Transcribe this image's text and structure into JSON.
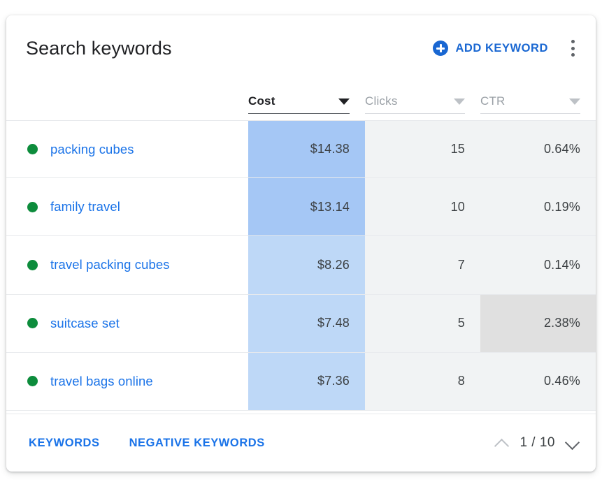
{
  "card": {
    "title": "Search keywords",
    "add_keyword_label": "ADD KEYWORD",
    "add_icon": "plus-circle-icon",
    "overflow_icon": "more-vert-icon",
    "accent_color": "#1a73e8",
    "add_button_color": "#1967d2",
    "status_dot_color": "#0d8c3c"
  },
  "table": {
    "columns": [
      {
        "label": "",
        "key": "keyword",
        "align": "left",
        "sorted": false
      },
      {
        "label": "Cost",
        "key": "cost",
        "align": "right",
        "sorted": true,
        "sort_icon": "caret-down-icon"
      },
      {
        "label": "Clicks",
        "key": "clicks",
        "align": "right",
        "sorted": false,
        "sort_icon": "caret-down-icon"
      },
      {
        "label": "CTR",
        "key": "ctr",
        "align": "right",
        "sorted": false,
        "sort_icon": "caret-down-icon"
      }
    ],
    "rows": [
      {
        "status": "enabled",
        "keyword": "packing cubes",
        "cost": "$14.38",
        "clicks": "15",
        "ctr": "0.64%",
        "cost_shade": "#a5c7f5",
        "ctr_highlight": false
      },
      {
        "status": "enabled",
        "keyword": "family travel",
        "cost": "$13.14",
        "clicks": "10",
        "ctr": "0.19%",
        "cost_shade": "#a5c7f5",
        "ctr_highlight": false
      },
      {
        "status": "enabled",
        "keyword": "travel packing cubes",
        "cost": "$8.26",
        "clicks": "7",
        "ctr": "0.14%",
        "cost_shade": "#bed8f7",
        "ctr_highlight": false
      },
      {
        "status": "enabled",
        "keyword": "suitcase set",
        "cost": "$7.48",
        "clicks": "5",
        "ctr": "2.38%",
        "cost_shade": "#bed8f7",
        "ctr_highlight": true
      },
      {
        "status": "enabled",
        "keyword": "travel bags online",
        "cost": "$7.36",
        "clicks": "8",
        "ctr": "0.46%",
        "cost_shade": "#bed8f7",
        "ctr_highlight": false
      }
    ]
  },
  "footer": {
    "tabs": [
      {
        "label": "KEYWORDS"
      },
      {
        "label": "NEGATIVE KEYWORDS"
      }
    ],
    "pagination": {
      "prev_icon": "chevron-up-icon",
      "next_icon": "chevron-down-icon",
      "page_text": "1 / 10"
    }
  }
}
